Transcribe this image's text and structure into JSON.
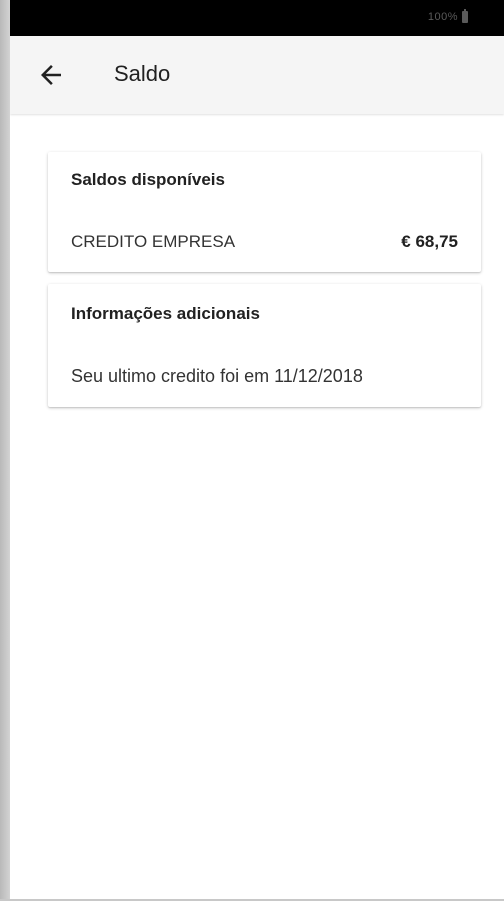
{
  "status_bar": {
    "battery_text": "100%",
    "battery_icon": "battery-icon"
  },
  "app_bar": {
    "back_icon": "arrow-back-icon",
    "title": "Saldo"
  },
  "balances_card": {
    "title": "Saldos disponíveis",
    "items": [
      {
        "name": "CREDITO EMPRESA",
        "amount": "€ 68,75"
      }
    ]
  },
  "info_card": {
    "title": "Informações adicionais",
    "text": "Seu ultimo credito foi em 11/12/2018"
  }
}
